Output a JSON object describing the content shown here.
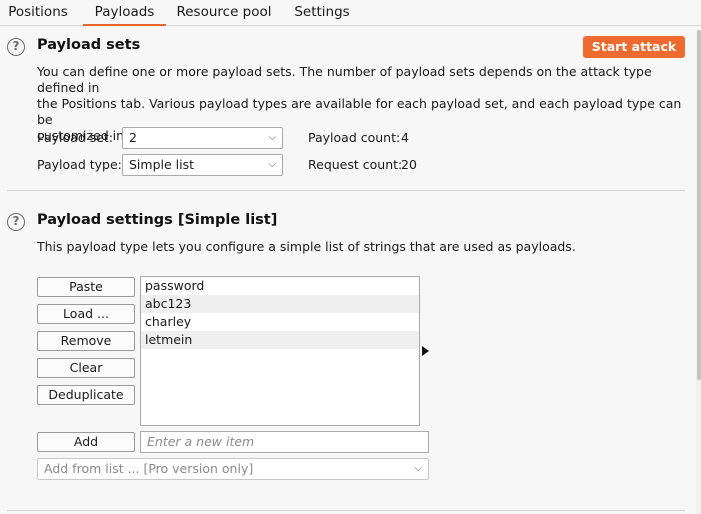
{
  "tabs": [
    {
      "label": "Positions",
      "active": false
    },
    {
      "label": "Payloads",
      "active": true
    },
    {
      "label": "Resource pool",
      "active": false
    },
    {
      "label": "Settings",
      "active": false
    }
  ],
  "payload_sets": {
    "title": "Payload sets",
    "description": "You can define one or more payload sets. The number of payload sets depends on the attack type defined in the Positions tab. Various payload types are available for each payload set, and each payload type can be customized in different ways.",
    "description_lines": [
      "You can define one or more payload sets. The number of payload sets depends on the attack type defined in",
      "the Positions tab. Various payload types are available for each payload set, and each payload type can be",
      "customized in different ways."
    ],
    "start_attack_label": "Start attack",
    "payload_set_label": "Payload set:",
    "payload_set_value": "2",
    "payload_type_label": "Payload type:",
    "payload_type_value": "Simple list",
    "payload_count_label": "Payload count:",
    "payload_count_value": "4",
    "request_count_label": "Request count:",
    "request_count_value": "20"
  },
  "payload_settings": {
    "title": "Payload settings [Simple list]",
    "description": "This payload type lets you configure a simple list of strings that are used as payloads.",
    "buttons": {
      "paste": "Paste",
      "load": "Load ...",
      "remove": "Remove",
      "clear": "Clear",
      "deduplicate": "Deduplicate",
      "add": "Add"
    },
    "items": [
      "password",
      "abc123",
      "charley",
      "letmein"
    ],
    "new_item_placeholder": "Enter a new item",
    "add_from_list_value": "Add from list ... [Pro version only]"
  },
  "colors": {
    "accent": "#e8662c",
    "start_button": "#ef6a2f"
  },
  "icons": {
    "help": "help-circle-icon",
    "dropdown": "chevron-down-icon",
    "row_pointer": "triangle-right-icon"
  }
}
